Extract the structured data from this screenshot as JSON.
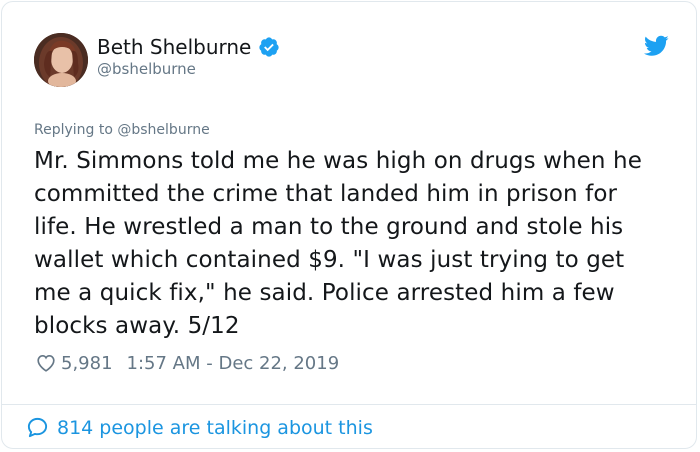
{
  "author": {
    "display_name": "Beth Shelburne",
    "handle": "@bshelburne",
    "verified": true
  },
  "reply": {
    "replying_to": "Replying to @bshelburne"
  },
  "tweet": {
    "text": "Mr. Simmons told me he was high on drugs when he\ncommitted the crime that landed him in prison for\nlife. He wrestled a man to the ground and stole his\nwallet which contained $9. \"I was just trying to get\nme a quick fix,\" he said. Police arrested him a few\nblocks away. 5/12"
  },
  "meta": {
    "likes": "5,981",
    "timestamp": "1:57 AM - Dec 22, 2019"
  },
  "footer": {
    "talking_label": "814 people are talking about this"
  },
  "colors": {
    "brand_blue": "#1da1f2",
    "link_blue": "#1b95e0",
    "secondary_text": "#657786"
  },
  "icons": {
    "verified": "verified-badge-icon",
    "brand": "twitter-bird-icon",
    "like": "heart-icon",
    "talking": "speech-bubble-icon"
  }
}
